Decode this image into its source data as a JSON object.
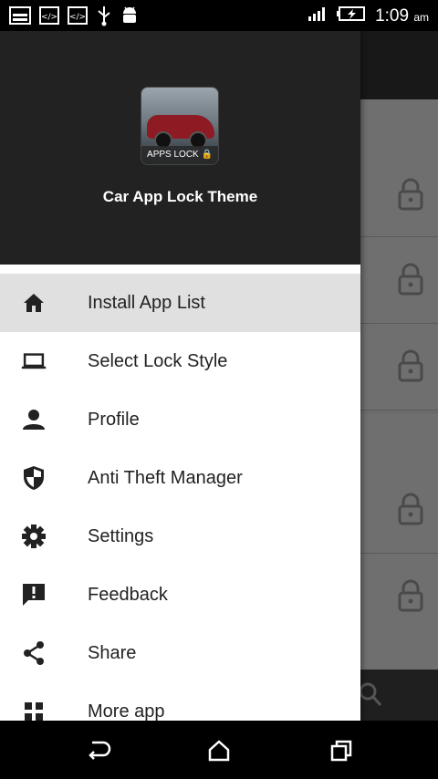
{
  "status_bar": {
    "left_icons": [
      "gallery-icon",
      "code-icon",
      "code-icon",
      "usb-icon",
      "android-icon"
    ],
    "right_icons": [
      "signal-icon",
      "battery-charging-icon"
    ],
    "time": "1:09",
    "ampm": "am"
  },
  "drawer": {
    "app_icon_label": "APPS LOCK",
    "app_title": "Car App Lock Theme",
    "items": [
      {
        "label": "Install App List",
        "icon": "home-icon",
        "active": true
      },
      {
        "label": "Select Lock Style",
        "icon": "laptop-icon",
        "active": false
      },
      {
        "label": "Profile",
        "icon": "person-icon",
        "active": false
      },
      {
        "label": "Anti Theft Manager",
        "icon": "shield-icon",
        "active": false
      },
      {
        "label": "Settings",
        "icon": "gear-icon",
        "active": false
      },
      {
        "label": "Feedback",
        "icon": "feedback-icon",
        "active": false
      },
      {
        "label": "Share",
        "icon": "share-icon",
        "active": false
      },
      {
        "label": "More app",
        "icon": "grid-icon",
        "active": false
      }
    ]
  },
  "background_app": {
    "row_icons": [
      "lock-icon",
      "lock-icon",
      "lock-icon",
      "lock-icon",
      "lock-icon"
    ],
    "bottom_icon": "search-icon"
  },
  "nav_bar": {
    "buttons": [
      "back-icon",
      "home-icon",
      "recents-icon"
    ]
  },
  "colors": {
    "header_bg": "#222222",
    "active_item_bg": "#e0e0e0",
    "text": "#222222"
  }
}
